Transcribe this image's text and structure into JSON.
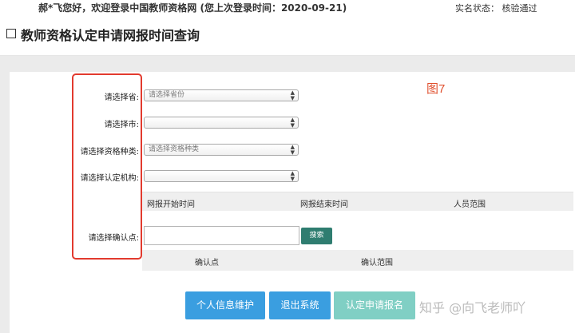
{
  "header": {
    "welcome_text": "郝*飞您好，欢迎登录中国教师资格网 (您上次登录时间：2020-09-21)",
    "status_text": "实名状态：  核验通过"
  },
  "page": {
    "title": "教师资格认定申请网报时间查询"
  },
  "annotation": {
    "figure_label": "图7"
  },
  "form": {
    "province_label": "请选择省:",
    "province_placeholder": "请选择省份",
    "city_label": "请选择市:",
    "city_value": "",
    "type_label": "请选择资格种类:",
    "type_placeholder": "请选择资格种类",
    "agency_label": "请选择认定机构:",
    "agency_value": "",
    "confirm_label": "请选择确认点:",
    "confirm_value": "",
    "search_label": "搜索"
  },
  "grid1": {
    "columns": [
      "网报开始时间",
      "网报结束时间",
      "人员范围"
    ]
  },
  "grid2": {
    "columns": [
      "确认点",
      "确认范围"
    ]
  },
  "actions": {
    "personal_info": "个人信息维护",
    "logout": "退出系统",
    "apply": "认定申请报名"
  },
  "watermark": {
    "text": "知乎 @向飞老师吖"
  },
  "colors": {
    "primary_button": "#3a9ee0",
    "apply_button": "#80cfc4",
    "search_button": "#2f7d70",
    "annotation_red": "#e23a2e"
  }
}
